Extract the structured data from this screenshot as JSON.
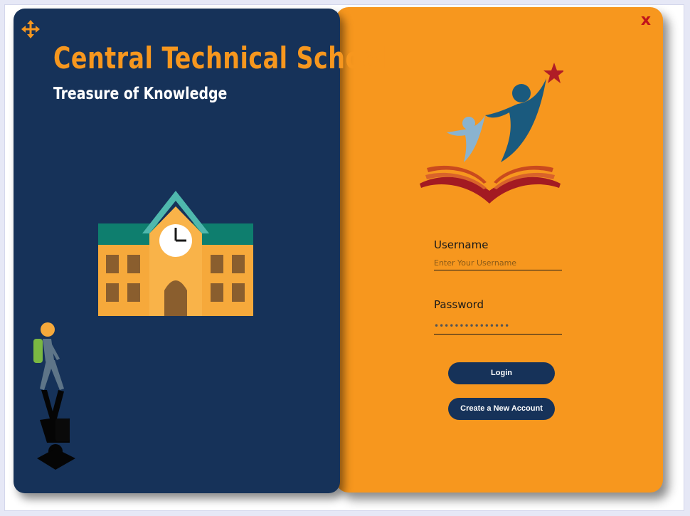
{
  "app": {
    "title": "Central Technical School",
    "subtitle": "Treasure of Knowledge",
    "close_label": "x"
  },
  "icons": {
    "move": "move-arrows-icon",
    "building": "school-building-icon",
    "student": "student-walking-icon",
    "logo": "education-book-star-logo",
    "close": "close-icon"
  },
  "login_form": {
    "username_label": "Username",
    "username_placeholder": "Enter Your Username",
    "username_value": "",
    "password_label": "Password",
    "password_value": "•••••••••••••••",
    "login_button": "Login",
    "create_account_button": "Create a New Account"
  },
  "colors": {
    "left_panel": "#163259",
    "right_panel": "#f7971e",
    "accent_title": "#f7971e",
    "close_red": "#c0141b",
    "button_bg": "#163259"
  }
}
